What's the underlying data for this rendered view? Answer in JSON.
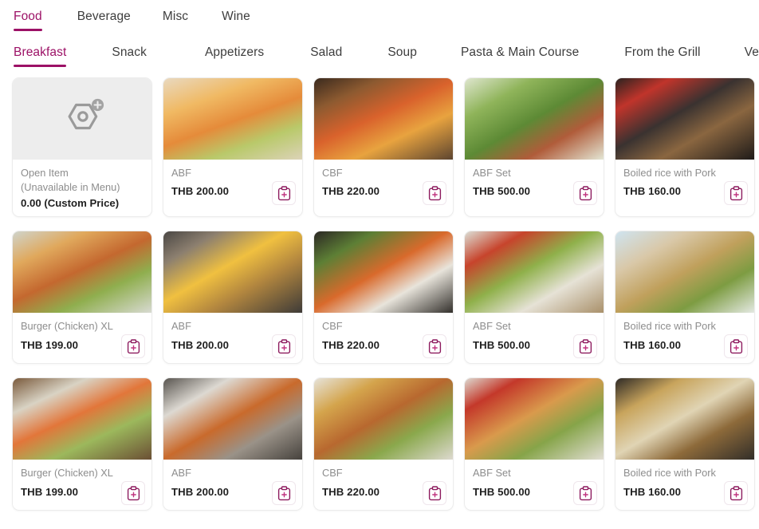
{
  "primary_tabs": [
    {
      "label": "Food",
      "active": true
    },
    {
      "label": "Beverage",
      "active": false
    },
    {
      "label": "Misc",
      "active": false
    },
    {
      "label": "Wine",
      "active": false
    }
  ],
  "secondary_tabs": [
    {
      "label": "Breakfast",
      "active": true
    },
    {
      "label": "Snack",
      "active": false
    },
    {
      "label": "Appetizers",
      "active": false
    },
    {
      "label": "Salad",
      "active": false
    },
    {
      "label": "Soup",
      "active": false
    },
    {
      "label": "Pasta & Main Course",
      "active": false
    },
    {
      "label": "From the Grill",
      "active": false
    },
    {
      "label": "Vegetarian",
      "active": false
    }
  ],
  "accent_color": "#9c1166",
  "open_item": {
    "line1": "Open Item",
    "line2": "(Unavailable in Menu)",
    "price": "0.00 (Custom Price)",
    "icon": "hexagon-plus-icon"
  },
  "add_button_icon": "clipboard-plus-icon",
  "rows": [
    {
      "items": [
        {
          "name": "ABF",
          "price": "THB 200.00",
          "img": "c1"
        },
        {
          "name": "CBF",
          "price": "THB 220.00",
          "img": "c2"
        },
        {
          "name": "ABF Set",
          "price": "THB 500.00",
          "img": "c3"
        },
        {
          "name": "Boiled rice with Pork",
          "price": "THB 160.00",
          "img": "c4"
        }
      ]
    },
    {
      "items": [
        {
          "name": "Burger (Chicken) XL",
          "price": "THB 199.00",
          "img": "c5"
        },
        {
          "name": "ABF",
          "price": "THB 200.00",
          "img": "c6"
        },
        {
          "name": "CBF",
          "price": "THB 220.00",
          "img": "c7"
        },
        {
          "name": "ABF Set",
          "price": "THB 500.00",
          "img": "c8"
        },
        {
          "name": "Boiled rice with Pork",
          "price": "THB 160.00",
          "img": "c9"
        }
      ]
    },
    {
      "items": [
        {
          "name": "Burger (Chicken) XL",
          "price": "THB 199.00",
          "img": "c10"
        },
        {
          "name": "ABF",
          "price": "THB 200.00",
          "img": "c11"
        },
        {
          "name": "CBF",
          "price": "THB 220.00",
          "img": "c12"
        },
        {
          "name": "ABF Set",
          "price": "THB 500.00",
          "img": "c13"
        },
        {
          "name": "Boiled rice with Pork",
          "price": "THB 160.00",
          "img": "c14"
        }
      ]
    }
  ]
}
